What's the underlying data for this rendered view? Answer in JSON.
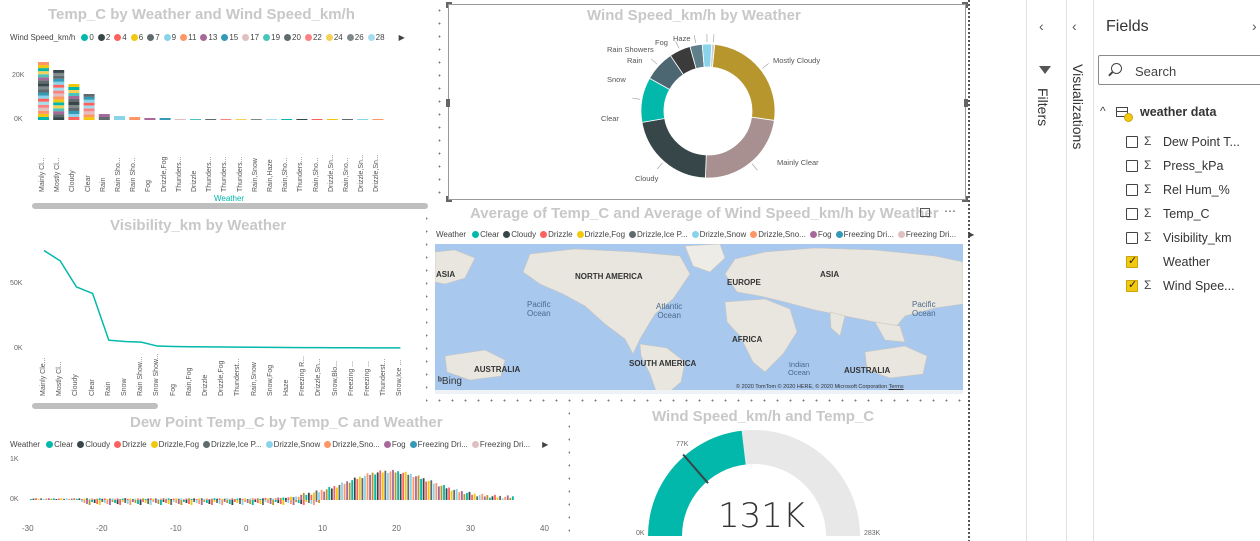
{
  "chart1": {
    "title": "Temp_C by Weather and Wind Speed_km/h",
    "legend_label": "Wind Speed_km/h",
    "legend_items": [
      "0",
      "2",
      "4",
      "6",
      "7",
      "9",
      "11",
      "13",
      "15",
      "17",
      "19",
      "20",
      "22",
      "24",
      "26",
      "28"
    ],
    "legend_colors": [
      "#01b8aa",
      "#374649",
      "#fd625e",
      "#f2c80f",
      "#5f6b6d",
      "#8ad4eb",
      "#fe9666",
      "#a66999",
      "#3599b8",
      "#dfbfbf",
      "#4ac5bb",
      "#5f6b6d",
      "#fb8281",
      "#f4d25a",
      "#7f898a",
      "#a4ddee"
    ],
    "y_ticks": [
      "20K",
      "0K"
    ],
    "categories": [
      "Mainly Cl...",
      "Mostly Cl...",
      "Cloudy",
      "Clear",
      "Rain",
      "Rain Sho...",
      "Rain Sho...",
      "Fog",
      "Drizzle,Fog",
      "Thunders...",
      "Drizzle",
      "Thunders...",
      "Thunders...",
      "Thunders...",
      "Rain,Snow",
      "Rain,Haze",
      "Rain,Sho...",
      "Thunders...",
      "Rain,Sho...",
      "Drizzle,Sn...",
      "Rain,Sno...",
      "Drizzle,Sn...",
      "Drizzle,Sn..."
    ],
    "x_axis_label": "Weather"
  },
  "chart2": {
    "title": "Wind Speed_km/h by Weather",
    "chart_data": {
      "type": "pie",
      "labels": [
        "Mostly Cloudy",
        "Mainly Clear",
        "Cloudy",
        "Clear",
        "Snow",
        "Rain",
        "Rain Showers",
        "Fog",
        "Haze"
      ],
      "values": [
        22.5,
        20.5,
        19.0,
        9.5,
        6.5,
        4.5,
        2.6,
        2.0,
        0.6
      ],
      "colors": [
        "#b8962e",
        "#a89090",
        "#374649",
        "#01b8aa",
        "#4c6672",
        "#3b3b3b",
        "#5f7f8a",
        "#8ad4eb",
        "#cfcfcf"
      ]
    }
  },
  "chart3": {
    "title": "Visibility_km by Weather",
    "y_ticks": [
      "50K",
      "0K"
    ],
    "categories": [
      "Mainly Cle...",
      "Mostly Cl...",
      "Cloudy",
      "Clear",
      "Rain",
      "Snow",
      "Rain Show...",
      "Snow Show...",
      "Fog",
      "Rain,Fog",
      "Drizzle",
      "Drizzle,Fog",
      "Thunderst...",
      "Rain,Snow",
      "Snow,Fog",
      "Haze",
      "Freezing R...",
      "Drizzle,Sn...",
      "Snow,Blo...",
      "Freezing ...",
      "Freezing ...",
      "Thunderst...",
      "Snow,Ice ..."
    ],
    "chart_data": {
      "type": "line",
      "values": [
        75000,
        67000,
        47000,
        42000,
        6000,
        5000,
        4500,
        1500,
        1200,
        1000,
        900,
        800,
        700,
        600,
        500,
        400,
        300,
        300,
        200,
        200,
        100,
        100,
        100
      ]
    }
  },
  "map": {
    "title": "Average of Temp_C and Average of Wind Speed_km/h by Weather",
    "legend_label": "Weather",
    "legend_items": [
      "Clear",
      "Cloudy",
      "Drizzle",
      "Drizzle,Fog",
      "Drizzle,Ice P...",
      "Drizzle,Snow",
      "Drizzle,Sno...",
      "Fog",
      "Freezing Dri...",
      "Freezing Dri..."
    ],
    "legend_colors": [
      "#01b8aa",
      "#374649",
      "#fd625e",
      "#f2c80f",
      "#5f6b6d",
      "#8ad4eb",
      "#fe9666",
      "#a66999",
      "#3599b8",
      "#dfbfbf"
    ],
    "labels": {
      "asia_left": "ASIA",
      "north_america": "NORTH AMERICA",
      "europe": "EUROPE",
      "asia_right": "ASIA",
      "pacific_left": "Pacific\nOcean",
      "atlantic": "Atlantic\nOcean",
      "pacific_right": "Pacific\nOcean",
      "africa": "AFRICA",
      "indian": "Indian\nOcean",
      "australia_left": "AUSTRALIA",
      "south_america": "SOUTH AMERICA",
      "australia_right": "AUSTRALIA"
    },
    "bing": "Bing",
    "copyright": "© 2020 TomTom © 2020 HERE, © 2020 Microsoft Corporation",
    "terms": "Terms"
  },
  "chart4": {
    "title": "Dew Point Temp_C by Temp_C and Weather",
    "legend_label": "Weather",
    "legend_items": [
      "Clear",
      "Cloudy",
      "Drizzle",
      "Drizzle,Fog",
      "Drizzle,Ice P...",
      "Drizzle,Snow",
      "Drizzle,Sno...",
      "Fog",
      "Freezing Dri...",
      "Freezing Dri..."
    ],
    "legend_colors": [
      "#01b8aa",
      "#374649",
      "#fd625e",
      "#f2c80f",
      "#5f6b6d",
      "#8ad4eb",
      "#fe9666",
      "#a66999",
      "#3599b8",
      "#dfbfbf"
    ],
    "y_ticks": [
      "1K",
      "0K"
    ],
    "x_ticks": [
      "-30",
      "-20",
      "-10",
      "0",
      "10",
      "20",
      "30",
      "40"
    ]
  },
  "gauge": {
    "title": "Wind Speed_km/h and Temp_C",
    "value_label": "131K",
    "target_label": "77K",
    "min_label": "0K",
    "max_label": "283K",
    "chart_data": {
      "type": "gauge",
      "value": 131000,
      "target": 77000,
      "min": 0,
      "max": 283000
    }
  },
  "panes": {
    "filters": "Filters",
    "visualizations": "Visualizations",
    "fields": "Fields",
    "search_placeholder": "Search",
    "table_name": "weather data",
    "fields_list": [
      {
        "name": "Dew Point T...",
        "sigma": true,
        "checked": false
      },
      {
        "name": "Press_kPa",
        "sigma": true,
        "checked": false
      },
      {
        "name": "Rel Hum_%",
        "sigma": true,
        "checked": false
      },
      {
        "name": "Temp_C",
        "sigma": true,
        "checked": false
      },
      {
        "name": "Visibility_km",
        "sigma": true,
        "checked": false
      },
      {
        "name": "Weather",
        "sigma": false,
        "checked": true
      },
      {
        "name": "Wind Spee...",
        "sigma": true,
        "checked": true
      }
    ]
  }
}
